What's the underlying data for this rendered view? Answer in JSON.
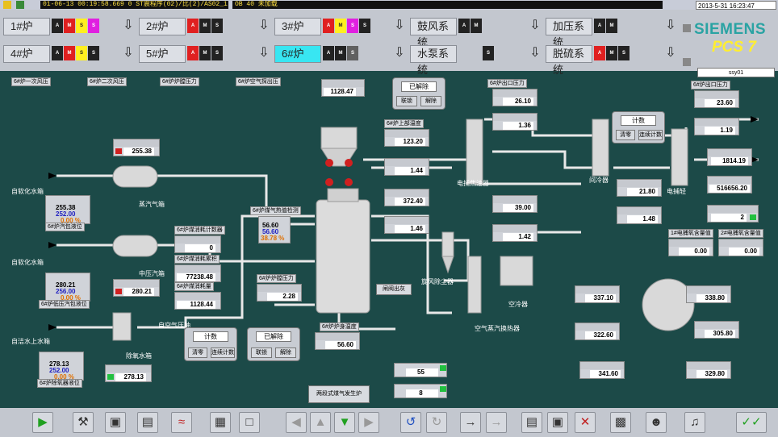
{
  "status": {
    "time": "01-06-13 00:19:58.669 0  ST震程序(02)/比(2)/AS02_1",
    "message": "OB 40 未加载",
    "datetime": "2013-5-31 16:23:47"
  },
  "brand": {
    "name": "SIEMENS",
    "product": "PCS 7"
  },
  "user": "ssy01",
  "nav": [
    {
      "label": "1#炉",
      "active": false
    },
    {
      "label": "2#炉",
      "active": false
    },
    {
      "label": "3#炉",
      "active": false
    },
    {
      "label": "鼓风系统",
      "active": false
    },
    {
      "label": "加压系统",
      "active": false
    },
    {
      "label": "4#炉",
      "active": false
    },
    {
      "label": "5#炉",
      "active": false
    },
    {
      "label": "6#炉",
      "active": true
    },
    {
      "label": "水泵系统",
      "active": false
    },
    {
      "label": "脱硫系统",
      "active": false
    }
  ],
  "process": {
    "labels": {
      "tsu1": "6#炉一次风压",
      "tsu2": "6#炉二次风压",
      "tsu3": "6#炉炉膛压力",
      "tsu4": "6#炉空气探出压",
      "softwater1": "自软化水箱",
      "softwater2": "自软化水箱",
      "steam1": "蒸汽气箱",
      "drum1": "6#炉汽包液位",
      "steam2": "中压汽箱",
      "drum2": "6#炉低压汽包液位",
      "water": "自洁水上水箱",
      "tank": "除氧水箱",
      "drum3": "6#炉除氧器液位",
      "hydro": "自空气压轴",
      "coal": "6#炉煤消耗计数器",
      "coal2": "6#炉煤消耗累积",
      "coal3": "6#炉煤消耗量",
      "pressure": "6#炉炉膛压力",
      "gas": "6#炉煤气热值检测",
      "heater": "电捕焦油器",
      "cyclone": "旋风除尘器",
      "cooler": "空冷器",
      "tempctrl": "6#炉上部温度",
      "furnace": "6#炉炉身温度",
      "door": "闸阀出灰",
      "dual": "两段式煤气发生炉",
      "indirect": "间冷器",
      "electro": "电捕轻",
      "oilmeter": "电捕焦油器",
      "exchanger": "空气蒸汽换热器",
      "b1": "1#电捕氧含量值",
      "b2": "2#电捕氧含量值",
      "fan": "6#炉出口压力",
      "fan2": "6#炉出口温度",
      "fan3": "6#炉出口压力"
    },
    "values": {
      "v1": "1128.47",
      "v2": "255.38",
      "v3a": "255.38",
      "v3b": "252.00",
      "v3c": "0.00 %",
      "v4a": "280.21",
      "v4b": "256.00",
      "v4c": "0.00 %",
      "v5": "280.21",
      "v6a": "278.13",
      "v6b": "252.00",
      "v6c": "0.00 %",
      "v7": "278.13",
      "v8": "0",
      "v9": "77238.48",
      "v10": "1128.44",
      "v11a": "56.60",
      "v11b": "56.60",
      "v11c": "38.78 %",
      "v12": "2.28",
      "v13": "56.60",
      "v14": "123.20",
      "v15": "1.44",
      "v16": "372.40",
      "v17": "1.46",
      "v18": "26.10",
      "v19": "1.36",
      "v20": "21.80",
      "v21": "39.00",
      "v22": "1.48",
      "v23": "1.42",
      "v24": "23.60",
      "v25": "1.19",
      "v26": "1814.19",
      "v27": "516656.20",
      "v28": "2",
      "v29": "0.00",
      "v30": "0.00",
      "v31": "337.10",
      "v32": "322.60",
      "v33": "341.60",
      "v34": "338.80",
      "v35": "305.80",
      "v36": "329.80",
      "v37": "55",
      "v38": "8"
    },
    "panel1": {
      "title": "已解除",
      "b1": "联锁",
      "b2": "解除"
    },
    "panel2": {
      "title": "计数",
      "b1": "清零",
      "b2": "连续计数"
    },
    "panel3": {
      "title": "计数",
      "b1": "清零",
      "b2": "连续计数"
    },
    "panel4": {
      "title": "已解除",
      "b1": "联锁",
      "b2": "解除"
    }
  }
}
